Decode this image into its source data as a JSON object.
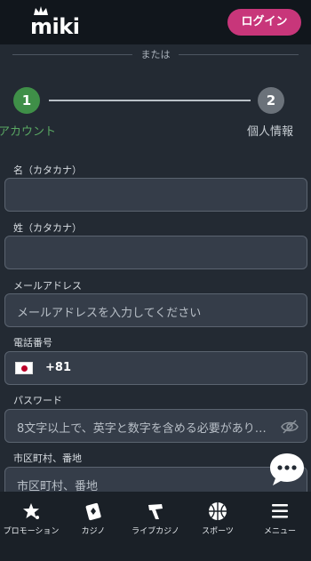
{
  "header": {
    "logo_text": "miki",
    "login_label": "ログイン"
  },
  "divider": {
    "text": "または"
  },
  "steps": [
    {
      "number": "1",
      "label": "アカウント",
      "active": true
    },
    {
      "number": "2",
      "label": "個人情報",
      "active": false
    }
  ],
  "form": {
    "first_name": {
      "label": "名（カタカナ）",
      "value": ""
    },
    "last_name": {
      "label": "姓（カタカナ）",
      "value": ""
    },
    "email": {
      "label": "メールアドレス",
      "placeholder": "メールアドレスを入力してください"
    },
    "phone": {
      "label": "電話番号",
      "country_code": "+81"
    },
    "password": {
      "label": "パスワード",
      "placeholder": "8文字以上で、英字と数字を含める必要があり…"
    },
    "address": {
      "label": "市区町村、番地",
      "placeholder": "市区町村、番地"
    }
  },
  "bottom_nav": [
    {
      "label": "プロモーション",
      "icon": "star-icon"
    },
    {
      "label": "カジノ",
      "icon": "cards-icon"
    },
    {
      "label": "ライブカジノ",
      "icon": "live-casino-icon"
    },
    {
      "label": "スポーツ",
      "icon": "basketball-icon"
    },
    {
      "label": "メニュー",
      "icon": "menu-icon"
    }
  ],
  "colors": {
    "accent": "#c8367a",
    "step_active": "#3f8f48",
    "step_inactive": "#6b727a",
    "background": "#232a33"
  }
}
